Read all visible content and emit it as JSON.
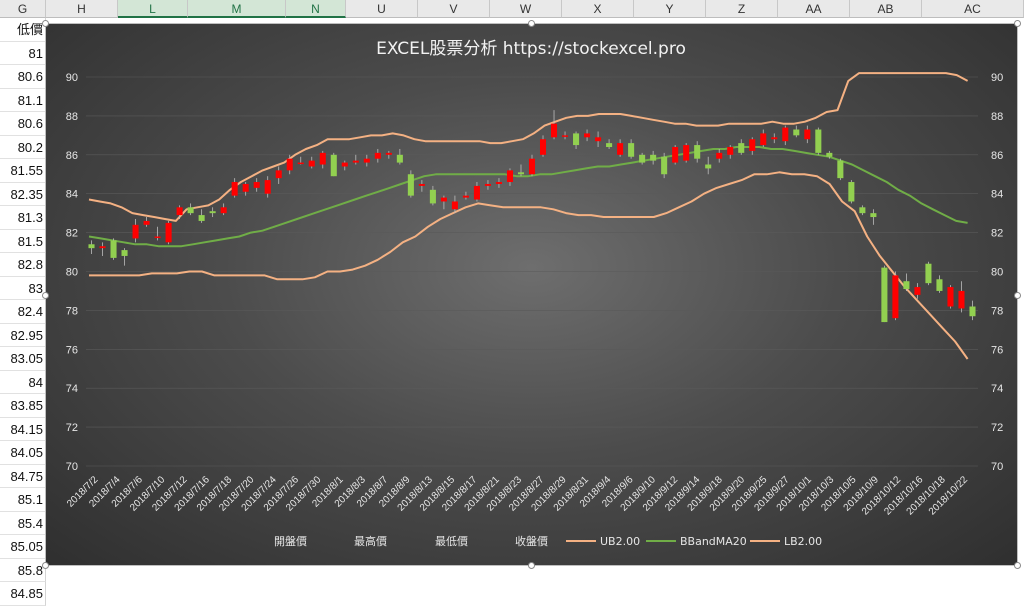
{
  "spreadsheet": {
    "column_headers": [
      {
        "label": "G",
        "selected": false
      },
      {
        "label": "H",
        "selected": false
      },
      {
        "label": "L",
        "selected": true
      },
      {
        "label": "M",
        "selected": true
      },
      {
        "label": "N",
        "selected": true
      },
      {
        "label": "U",
        "selected": false
      },
      {
        "label": "V",
        "selected": false
      },
      {
        "label": "W",
        "selected": false
      },
      {
        "label": "X",
        "selected": false
      },
      {
        "label": "Y",
        "selected": false
      },
      {
        "label": "Z",
        "selected": false
      },
      {
        "label": "AA",
        "selected": false
      },
      {
        "label": "AB",
        "selected": false
      },
      {
        "label": "AC",
        "selected": false
      }
    ],
    "column_g_values": [
      "低價",
      "81",
      "80.6",
      "81.1",
      "80.6",
      "80.2",
      "81.55",
      "82.35",
      "81.3",
      "81.5",
      "82.8",
      "83",
      "82.4",
      "82.95",
      "83.05",
      "84",
      "83.85",
      "84.15",
      "84.05",
      "84.75",
      "85.1",
      "85.4",
      "85.05",
      "85.8",
      "84.85"
    ]
  },
  "chart_data": {
    "type": "candlestick",
    "title": "EXCEL股票分析 https://stockexcel.pro",
    "ylim": [
      70,
      90
    ],
    "y_ticks": [
      70,
      72,
      74,
      76,
      78,
      80,
      82,
      84,
      86,
      88,
      90
    ],
    "x_tick_labels": [
      "2018/7/2",
      "2018/7/4",
      "2018/7/6",
      "2018/7/10",
      "2018/7/12",
      "2018/7/16",
      "2018/7/18",
      "2018/7/20",
      "2018/7/24",
      "2018/7/26",
      "2018/7/30",
      "2018/8/1",
      "2018/8/3",
      "2018/8/7",
      "2018/8/9",
      "2018/8/13",
      "2018/8/15",
      "2018/8/17",
      "2018/8/21",
      "2018/8/23",
      "2018/8/27",
      "2018/8/29",
      "2018/8/31",
      "2018/9/4",
      "2018/9/6",
      "2018/9/10",
      "2018/9/12",
      "2018/9/14",
      "2018/9/18",
      "2018/9/20",
      "2018/9/25",
      "2018/9/27",
      "2018/10/1",
      "2018/10/3",
      "2018/10/5",
      "2018/10/9",
      "2018/10/12",
      "2018/10/16",
      "2018/10/18",
      "2018/10/22"
    ],
    "legend": [
      "開盤價",
      "最高價",
      "最低價",
      "收盤價",
      "UB2.00",
      "BBandMA20",
      "LB2.00"
    ],
    "legend_position": "bottom",
    "colors": {
      "up": "#ff0000",
      "down": "#92d050",
      "upper_band": "#f4b183",
      "middle_band": "#70ad47",
      "lower_band": "#f4b183"
    },
    "candles": [
      {
        "open": 81.4,
        "high": 81.6,
        "low": 80.9,
        "close": 81.2
      },
      {
        "open": 81.2,
        "high": 81.5,
        "low": 80.8,
        "close": 81.3
      },
      {
        "open": 81.6,
        "high": 81.7,
        "low": 80.6,
        "close": 80.7
      },
      {
        "open": 81.1,
        "high": 81.2,
        "low": 80.3,
        "close": 80.8
      },
      {
        "open": 81.7,
        "high": 82.7,
        "low": 81.5,
        "close": 82.4
      },
      {
        "open": 82.4,
        "high": 82.8,
        "low": 82.3,
        "close": 82.6
      },
      {
        "open": 81.8,
        "high": 82.3,
        "low": 81.6,
        "close": 81.8
      },
      {
        "open": 81.5,
        "high": 82.6,
        "low": 81.4,
        "close": 82.5
      },
      {
        "open": 82.9,
        "high": 83.4,
        "low": 82.7,
        "close": 83.3
      },
      {
        "open": 83.3,
        "high": 83.5,
        "low": 82.9,
        "close": 83.0
      },
      {
        "open": 82.9,
        "high": 83.2,
        "low": 82.5,
        "close": 82.6
      },
      {
        "open": 83.1,
        "high": 83.3,
        "low": 82.8,
        "close": 83.0
      },
      {
        "open": 83.0,
        "high": 83.5,
        "low": 82.9,
        "close": 83.3
      },
      {
        "open": 83.9,
        "high": 84.8,
        "low": 83.8,
        "close": 84.6
      },
      {
        "open": 84.1,
        "high": 84.6,
        "low": 83.9,
        "close": 84.5
      },
      {
        "open": 84.3,
        "high": 84.8,
        "low": 84.1,
        "close": 84.6
      },
      {
        "open": 84.0,
        "high": 84.9,
        "low": 83.8,
        "close": 84.7
      },
      {
        "open": 84.8,
        "high": 85.4,
        "low": 84.5,
        "close": 85.2
      },
      {
        "open": 85.2,
        "high": 86.0,
        "low": 85.0,
        "close": 85.8
      },
      {
        "open": 85.6,
        "high": 85.9,
        "low": 85.5,
        "close": 85.6
      },
      {
        "open": 85.4,
        "high": 85.9,
        "low": 85.3,
        "close": 85.7
      },
      {
        "open": 85.5,
        "high": 86.2,
        "low": 85.3,
        "close": 86.1
      },
      {
        "open": 86.0,
        "high": 86.1,
        "low": 84.9,
        "close": 84.9
      },
      {
        "open": 85.4,
        "high": 85.7,
        "low": 85.2,
        "close": 85.6
      },
      {
        "open": 85.6,
        "high": 86.0,
        "low": 85.5,
        "close": 85.7
      },
      {
        "open": 85.6,
        "high": 86.0,
        "low": 85.4,
        "close": 85.8
      },
      {
        "open": 85.8,
        "high": 86.3,
        "low": 85.6,
        "close": 86.1
      },
      {
        "open": 86.0,
        "high": 86.2,
        "low": 85.8,
        "close": 86.1
      },
      {
        "open": 86.0,
        "high": 86.3,
        "low": 85.5,
        "close": 85.6
      },
      {
        "open": 85.0,
        "high": 85.2,
        "low": 83.8,
        "close": 83.9
      },
      {
        "open": 84.4,
        "high": 84.7,
        "low": 84.1,
        "close": 84.5
      },
      {
        "open": 84.2,
        "high": 84.4,
        "low": 83.4,
        "close": 83.5
      },
      {
        "open": 83.6,
        "high": 83.9,
        "low": 83.2,
        "close": 83.8
      },
      {
        "open": 83.2,
        "high": 83.9,
        "low": 83.0,
        "close": 83.6
      },
      {
        "open": 83.8,
        "high": 84.1,
        "low": 83.7,
        "close": 83.9
      },
      {
        "open": 83.7,
        "high": 84.6,
        "low": 83.6,
        "close": 84.4
      },
      {
        "open": 84.4,
        "high": 84.7,
        "low": 84.2,
        "close": 84.5
      },
      {
        "open": 84.5,
        "high": 84.8,
        "low": 84.3,
        "close": 84.6
      },
      {
        "open": 84.6,
        "high": 85.3,
        "low": 84.4,
        "close": 85.2
      },
      {
        "open": 85.1,
        "high": 85.5,
        "low": 84.9,
        "close": 85.0
      },
      {
        "open": 85.0,
        "high": 86.0,
        "low": 84.9,
        "close": 85.8
      },
      {
        "open": 86.0,
        "high": 87.0,
        "low": 85.9,
        "close": 86.8
      },
      {
        "open": 86.9,
        "high": 88.3,
        "low": 86.8,
        "close": 87.6
      },
      {
        "open": 87.0,
        "high": 87.2,
        "low": 86.8,
        "close": 87.0
      },
      {
        "open": 87.1,
        "high": 87.2,
        "low": 86.3,
        "close": 86.5
      },
      {
        "open": 86.9,
        "high": 87.3,
        "low": 86.7,
        "close": 87.1
      },
      {
        "open": 86.7,
        "high": 87.2,
        "low": 86.4,
        "close": 86.9
      },
      {
        "open": 86.6,
        "high": 86.8,
        "low": 86.3,
        "close": 86.4
      },
      {
        "open": 86.0,
        "high": 86.8,
        "low": 85.9,
        "close": 86.6
      },
      {
        "open": 86.6,
        "high": 86.8,
        "low": 85.8,
        "close": 85.9
      },
      {
        "open": 86.0,
        "high": 86.1,
        "low": 85.5,
        "close": 85.6
      },
      {
        "open": 86.0,
        "high": 86.2,
        "low": 85.5,
        "close": 85.7
      },
      {
        "open": 85.9,
        "high": 86.1,
        "low": 84.8,
        "close": 85.0
      },
      {
        "open": 85.6,
        "high": 86.5,
        "low": 85.5,
        "close": 86.4
      },
      {
        "open": 85.7,
        "high": 86.6,
        "low": 85.6,
        "close": 86.5
      },
      {
        "open": 86.5,
        "high": 86.7,
        "low": 85.6,
        "close": 85.8
      },
      {
        "open": 85.5,
        "high": 85.9,
        "low": 85.0,
        "close": 85.3
      },
      {
        "open": 85.8,
        "high": 86.3,
        "low": 85.6,
        "close": 86.1
      },
      {
        "open": 86.0,
        "high": 86.5,
        "low": 85.8,
        "close": 86.4
      },
      {
        "open": 86.6,
        "high": 86.8,
        "low": 86.0,
        "close": 86.1
      },
      {
        "open": 86.2,
        "high": 86.9,
        "low": 86.0,
        "close": 86.8
      },
      {
        "open": 86.5,
        "high": 87.3,
        "low": 86.4,
        "close": 87.1
      },
      {
        "open": 86.8,
        "high": 87.1,
        "low": 86.6,
        "close": 86.9
      },
      {
        "open": 86.7,
        "high": 87.5,
        "low": 86.5,
        "close": 87.4
      },
      {
        "open": 87.3,
        "high": 87.5,
        "low": 86.9,
        "close": 87.0
      },
      {
        "open": 86.8,
        "high": 87.5,
        "low": 86.6,
        "close": 87.3
      },
      {
        "open": 87.3,
        "high": 87.4,
        "low": 86.0,
        "close": 86.1
      },
      {
        "open": 86.1,
        "high": 86.2,
        "low": 85.8,
        "close": 85.9
      },
      {
        "open": 85.7,
        "high": 85.8,
        "low": 84.7,
        "close": 84.8
      },
      {
        "open": 84.6,
        "high": 84.7,
        "low": 83.5,
        "close": 83.6
      },
      {
        "open": 83.3,
        "high": 83.4,
        "low": 82.9,
        "close": 83.0
      },
      {
        "open": 83.0,
        "high": 83.2,
        "low": 82.4,
        "close": 82.8
      },
      {
        "open": 80.2,
        "high": 80.3,
        "low": 77.4,
        "close": 77.4
      },
      {
        "open": 77.6,
        "high": 80.0,
        "low": 77.5,
        "close": 79.8
      },
      {
        "open": 79.5,
        "high": 79.9,
        "low": 79.0,
        "close": 79.1
      },
      {
        "open": 78.8,
        "high": 79.4,
        "low": 78.6,
        "close": 79.2
      },
      {
        "open": 80.4,
        "high": 80.5,
        "low": 79.3,
        "close": 79.4
      },
      {
        "open": 79.6,
        "high": 79.8,
        "low": 78.9,
        "close": 79.0
      },
      {
        "open": 78.2,
        "high": 79.3,
        "low": 78.1,
        "close": 79.2
      },
      {
        "open": 78.1,
        "high": 79.5,
        "low": 77.9,
        "close": 79.0
      },
      {
        "open": 78.2,
        "high": 78.5,
        "low": 77.5,
        "close": 77.7
      }
    ],
    "upper_band": [
      83.7,
      83.6,
      83.5,
      83.3,
      83.0,
      82.9,
      82.8,
      82.7,
      82.6,
      83.2,
      83.3,
      83.4,
      83.7,
      84.2,
      84.6,
      84.9,
      85.2,
      85.4,
      85.6,
      86.0,
      86.3,
      86.5,
      86.8,
      86.8,
      86.8,
      86.9,
      87.0,
      87.0,
      87.1,
      87.0,
      86.8,
      86.7,
      86.7,
      86.7,
      86.7,
      86.7,
      86.7,
      86.6,
      86.6,
      86.7,
      86.8,
      87.1,
      87.5,
      87.7,
      87.9,
      88.0,
      88.0,
      88.1,
      88.1,
      88.1,
      88.0,
      87.9,
      87.8,
      87.7,
      87.6,
      87.6,
      87.5,
      87.5,
      87.5,
      87.6,
      87.6,
      87.6,
      87.6,
      87.7,
      87.6,
      87.6,
      87.7,
      87.9,
      88.2,
      88.3,
      89.8,
      90.2,
      90.2,
      90.2,
      90.2,
      90.2,
      90.2,
      90.2,
      90.2,
      90.2,
      90.1,
      89.8
    ],
    "middle_band": [
      81.8,
      81.7,
      81.6,
      81.5,
      81.4,
      81.4,
      81.3,
      81.3,
      81.3,
      81.4,
      81.5,
      81.6,
      81.7,
      81.8,
      82.0,
      82.1,
      82.3,
      82.5,
      82.7,
      82.9,
      83.1,
      83.3,
      83.5,
      83.7,
      83.9,
      84.1,
      84.3,
      84.5,
      84.7,
      84.9,
      85.0,
      85.0,
      85.0,
      85.0,
      85.0,
      85.0,
      85.0,
      84.9,
      84.9,
      85.0,
      85.0,
      85.1,
      85.2,
      85.3,
      85.4,
      85.4,
      85.5,
      85.6,
      85.7,
      85.8,
      85.9,
      86.0,
      86.1,
      86.2,
      86.3,
      86.3,
      86.4,
      86.4,
      86.4,
      86.3,
      86.3,
      86.2,
      86.1,
      86.0,
      85.9,
      85.7,
      85.5,
      85.2,
      84.9,
      84.6,
      84.2,
      83.9,
      83.5,
      83.2,
      82.9,
      82.6,
      82.5
    ],
    "lower_band": [
      79.8,
      79.8,
      79.8,
      79.8,
      79.8,
      79.9,
      79.9,
      79.9,
      80.0,
      80.0,
      79.8,
      79.8,
      79.8,
      79.8,
      79.8,
      79.6,
      79.6,
      79.6,
      79.7,
      80.0,
      80.0,
      80.1,
      80.3,
      80.6,
      81.0,
      81.5,
      81.8,
      82.3,
      82.7,
      83.0,
      83.3,
      83.5,
      83.4,
      83.3,
      83.3,
      83.3,
      83.3,
      83.2,
      83.0,
      82.9,
      82.9,
      82.8,
      82.8,
      82.8,
      82.8,
      82.8,
      83.0,
      83.3,
      83.6,
      84.0,
      84.3,
      84.5,
      84.7,
      85.0,
      85.0,
      85.1,
      85.0,
      85.0,
      84.9,
      84.5,
      83.6,
      83.1,
      81.8,
      80.8,
      80.0,
      79.2,
      78.5,
      77.8,
      77.1,
      76.4,
      75.5
    ]
  }
}
